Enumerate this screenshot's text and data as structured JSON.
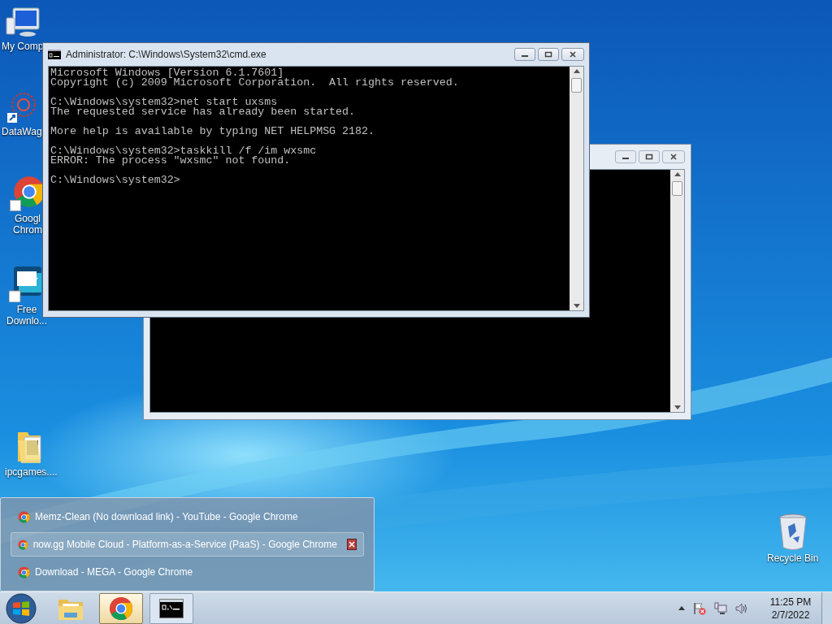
{
  "desktop_icons": [
    {
      "kind": "computer",
      "lines": [
        "My Comp"
      ]
    },
    {
      "kind": "app",
      "lines": [
        "DataWag"
      ]
    },
    {
      "kind": "chrome",
      "lines": [
        "Googl",
        "Chrom"
      ]
    },
    {
      "kind": "download",
      "lines": [
        "Free",
        "Downlo..."
      ]
    },
    {
      "kind": "folder",
      "lines": [
        "ipcgames...."
      ]
    },
    {
      "kind": "recycle",
      "lines": [
        "Recycle Bin"
      ]
    }
  ],
  "back_window": {
    "active": false
  },
  "cmd_window": {
    "active": true,
    "title": "Administrator: C:\\Windows\\System32\\cmd.exe",
    "blocks": [
      [
        "Microsoft Windows [Version 6.1.7601]",
        "Copyright (c) 2009 Microsoft Corporation.  All rights reserved."
      ],
      [
        "C:\\Windows\\system32>net start uxsms",
        "The requested service has already been started."
      ],
      [
        "More help is available by typing NET HELPMSG 2182."
      ],
      [
        "C:\\Windows\\system32>taskkill /f /im wxsmc",
        "ERROR: The process \"wxsmc\" not found."
      ],
      [
        "C:\\Windows\\system32>"
      ]
    ]
  },
  "thumbnail_list": [
    {
      "title": "Memz-Clean (No download link) - YouTube - Google Chrome",
      "selected": false
    },
    {
      "title": "now.gg Mobile Cloud - Platform-as-a-Service (PaaS) - Google Chrome",
      "selected": true
    },
    {
      "title": "Download - MEGA - Google Chrome",
      "selected": false
    }
  ],
  "taskbar": {
    "items": [
      {
        "kind": "start",
        "selected": false
      },
      {
        "kind": "explorer",
        "selected": false
      },
      {
        "kind": "chrome",
        "selected": true
      },
      {
        "kind": "cmd",
        "selected": false
      }
    ],
    "clock": {
      "time": "11:25 PM",
      "date": "2/7/2022"
    }
  }
}
